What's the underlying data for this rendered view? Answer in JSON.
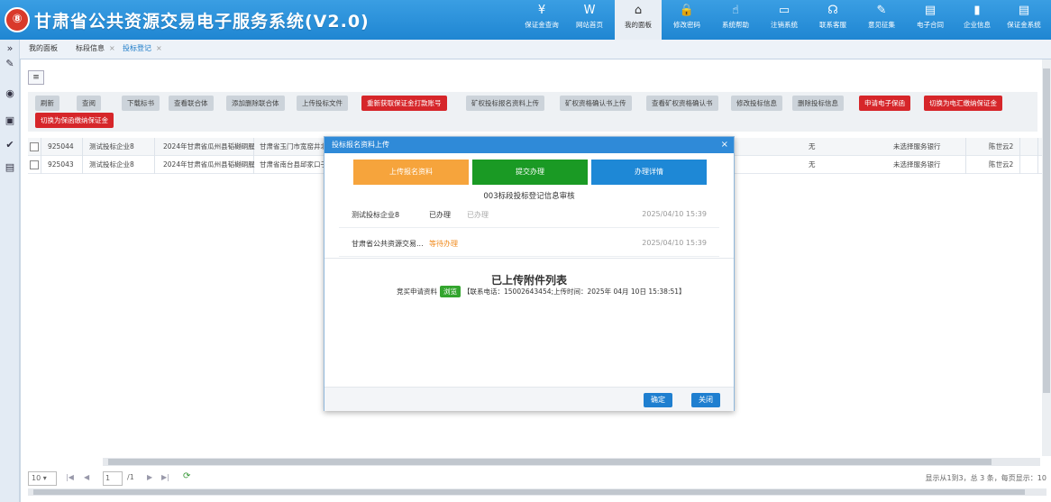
{
  "header": {
    "logo_glyph": "⑧",
    "title": "甘肃省公共资源交易电子服务系统(V2.0)",
    "nav": [
      {
        "icon": "¥",
        "label": "保证金查询",
        "icon_name": "yuan-icon"
      },
      {
        "icon": "W",
        "label": "网站首页",
        "icon_name": "website-icon"
      },
      {
        "icon": "⌂",
        "label": "我的面板",
        "icon_name": "home-icon"
      },
      {
        "icon": "🔒",
        "label": "修改密码",
        "icon_name": "lock-icon"
      },
      {
        "icon": "☝",
        "label": "系统帮助",
        "icon_name": "help-icon"
      },
      {
        "icon": "▭",
        "label": "注销系统",
        "icon_name": "logout-icon"
      },
      {
        "icon": "☊",
        "label": "联系客服",
        "icon_name": "headset-icon"
      },
      {
        "icon": "✎",
        "label": "意见征集",
        "icon_name": "edit-icon"
      },
      {
        "icon": "▤",
        "label": "电子合同",
        "icon_name": "contract-icon"
      },
      {
        "icon": "▮",
        "label": "企业信息",
        "icon_name": "company-icon"
      },
      {
        "icon": "▤",
        "label": "保证金系统",
        "icon_name": "deposit-system-icon"
      }
    ]
  },
  "left_bar": {
    "icons": [
      "»",
      "✎",
      "◉",
      "▣",
      "✔",
      "▤"
    ]
  },
  "tabs": [
    {
      "label": "我的面板",
      "closable": false
    },
    {
      "label": "标段信息",
      "closable": true
    },
    {
      "label": "投标登记",
      "closable": true,
      "active": true
    }
  ],
  "tab_close_glyph": "×",
  "toolbar": {
    "toggle_glyph": "≡",
    "buttons": [
      {
        "label": "刷新",
        "style": "gray"
      },
      {
        "label": "查阅",
        "style": "gray"
      },
      {
        "label": "下载标书",
        "style": "gray"
      },
      {
        "label": "查看联合体",
        "style": "gray"
      },
      {
        "label": "添加删除联合体",
        "style": "gray"
      },
      {
        "label": "上传投标文件",
        "style": "gray"
      },
      {
        "label": "重新获取保证金打款账号",
        "style": "red"
      },
      {
        "label": "矿权投标报名资料上传",
        "style": "gray"
      },
      {
        "label": "矿权资格确认书上传",
        "style": "gray"
      },
      {
        "label": "查看矿权资格确认书",
        "style": "gray"
      },
      {
        "label": "修改投标信息",
        "style": "gray"
      },
      {
        "label": "删除投标信息",
        "style": "gray"
      },
      {
        "label": "申请电子保函",
        "style": "red"
      },
      {
        "label": "切换为电汇缴纳保证金",
        "style": "red"
      },
      {
        "label": "切换为保函缴纳保证金",
        "style": "red"
      }
    ]
  },
  "table": {
    "rows": [
      {
        "id": "925044",
        "company": "测试投标企业8",
        "project": "2024年甘肃省瓜州县韬樾硐腥",
        "location": "甘肃省玉门市宽窑井北",
        "deposit": "无",
        "bank": "未选择服务银行",
        "person": "陈世云2",
        "extra": "1"
      },
      {
        "id": "925043",
        "company": "测试投标企业8",
        "project": "2024年甘肃省瓜州县韬樾硐腥",
        "location": "甘肃省南台县邱家口子",
        "deposit": "无",
        "bank": "未选择服务银行",
        "person": "陈世云2",
        "extra": "1"
      }
    ]
  },
  "pager": {
    "page_size": "10",
    "page": "1",
    "total_pages": "/1",
    "first": "|◀",
    "prev": "◀",
    "next": "▶",
    "last": "▶|",
    "refresh": "⟳",
    "summary": "显示从1到3，总 3 条，每页显示：10"
  },
  "modal": {
    "title": "投标报名资料上传",
    "close": "×",
    "steps": [
      {
        "label": "上传报名资料",
        "color": "#f6a43c"
      },
      {
        "label": "提交办理",
        "color": "#1a9a24"
      },
      {
        "label": "办理详情",
        "color": "#1e88d6"
      }
    ],
    "step_title": "003标段投标登记信息审核",
    "flow": [
      {
        "who": "测试投标企业8",
        "status": "已办理",
        "status_color": "#333",
        "status2": "已办理",
        "time": "2025/04/10 15:39"
      },
      {
        "who": "甘肃省公共资源交易...",
        "status": "等待办理",
        "status_color": "#f08a1c",
        "status2": "",
        "time": "2025/04/10 15:39"
      }
    ],
    "attachments_title": "已上传附件列表",
    "attachment": {
      "prefix": "竞买申请资料",
      "badge": "浏览",
      "detail": "【联系电话：15002643454;上传时间：2025年 04月 10日 15:38:51】"
    },
    "ok_label": "确定",
    "close_label": "关闭"
  }
}
